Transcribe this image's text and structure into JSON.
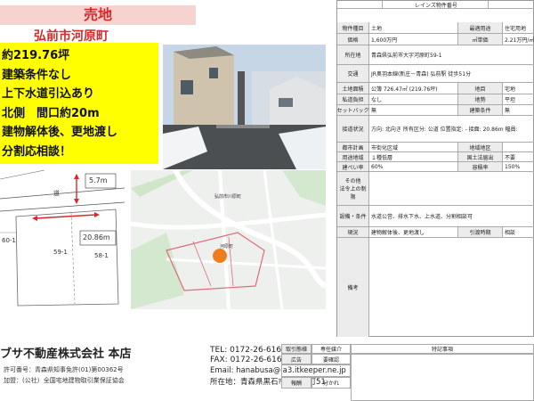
{
  "header": {
    "title": "売地",
    "city": "弘前市河原町"
  },
  "highlights": [
    "約219.76坪",
    "建築条件なし",
    "上下水道引込あり",
    "北側　間口約20m",
    "建物解体後、更地渡し",
    "分割応相談！"
  ],
  "survey": {
    "road_label": "道",
    "road_width": "5.7m",
    "frontage": "20.86m",
    "lot_a": "60-1",
    "lot_b": "59-1",
    "lot_c": "58-1"
  },
  "area_map": {
    "label_a": "弘前市川原町",
    "label_b": "河原町"
  },
  "company": {
    "name": "ブサ不動産株式会社 本店",
    "license": "許可番号：青森県知事免許(01)第00362号",
    "association": "加盟：(公社）全国宅地建物取引業保証協会",
    "tel": "TEL: 0172-26-6160",
    "fax": "FAX: 0172-26-6160",
    "email": "Email: hanabusa@ia3.itkeeper.ne.jp",
    "address": "所在地：青森県黒石市大字前町51"
  },
  "sheet": {
    "reins_label": "レインズ物件番号",
    "type_label": "物件種目",
    "type_value": "土地",
    "usage_label": "最適用途",
    "usage_value": "住宅用地",
    "price_label": "価格",
    "price_value": "1,600万円",
    "unit_price_label": "㎡単価",
    "unit_price_value": "2.21万円/㎡",
    "location_label": "所在地",
    "location_value": "青森県弘前市大字河原町59-1",
    "transport_label": "交通",
    "transport_value": "JR奥羽本線(新庄－青森) 弘前駅 徒歩51分",
    "land_area_label": "土地面積",
    "land_area_value": "公簿 726.47㎡ (219.76坪)",
    "land_cat_label": "地目",
    "land_cat_value": "宅地",
    "private_road_label": "私道負担",
    "private_road_value": "なし",
    "terrain_label": "地勢",
    "terrain_value": "平坦",
    "setback_label": "セットバック",
    "setback_value": "無",
    "building_cond_label": "建築条件",
    "building_cond_value": "無",
    "road_label": "接道状況",
    "road_value": "方向: 北向き 所有区分: 公道 位置指定: - 接面: 20.86m 幅員:",
    "planning_label": "都市計画",
    "planning_value": "市街化区域",
    "district_label": "地域地区",
    "district_value": "",
    "zoning_label": "用途地域",
    "zoning_value": "１種低層",
    "landlaw_label": "国土法届出",
    "landlaw_value": "不要",
    "bcr_label": "建ぺい率",
    "bcr_value": "60%",
    "far_label": "容積率",
    "far_value": "150%",
    "restrict_label": "その他\n法令上の制限",
    "restrict_value": "",
    "facilities_label": "設備・条件",
    "facilities_value": "水道公営、排水下水、上水道、分割相談可",
    "status_label": "現況",
    "status_value": "建物解体後、更地渡し",
    "handover_label": "引渡時期",
    "handover_value": "相談",
    "remarks_label": "備考"
  },
  "bottom": {
    "trade_label": "取引態様",
    "trade_value": "専任媒介",
    "notes_label": "特記事項",
    "ad_label": "広告",
    "ad_value": "要確認",
    "fee_label": "報酬",
    "fee_value": "分かれ"
  }
}
